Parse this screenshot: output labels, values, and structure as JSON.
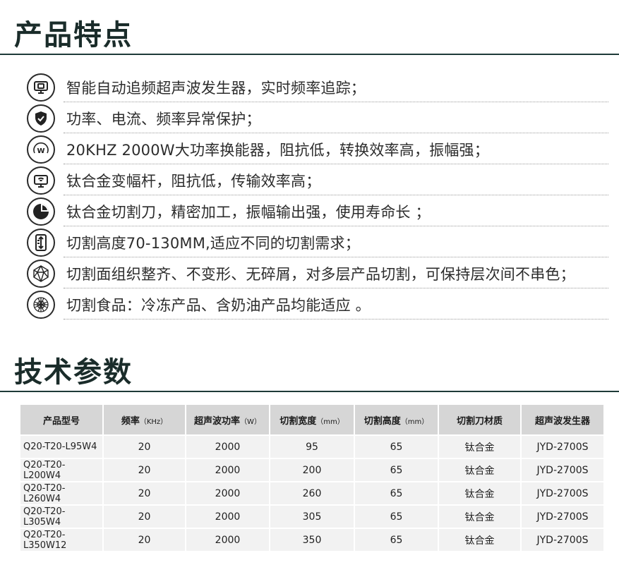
{
  "features_section": {
    "title": "产品特点",
    "items": [
      {
        "icon": "monitor-chip-icon",
        "text": "智能自动追频超声波发生器，实时频率追踪；"
      },
      {
        "icon": "shield-check-icon",
        "text": "功率、电流、频率异常保护；"
      },
      {
        "icon": "power-w-gauge-icon",
        "text": "20KHZ 2000W大功率换能器，阻抗低，转换效率高，振幅强；"
      },
      {
        "icon": "wireless-monitor-icon",
        "text": "钛合金变幅杆，阻抗低，传输效率高；"
      },
      {
        "icon": "pie-chart-icon",
        "text": "钛合金切割刀，精密加工，振幅输出强，使用寿命长 ；"
      },
      {
        "icon": "height-ruler-icon",
        "text": "切割高度70-130MM,适应不同的切割需求；"
      },
      {
        "icon": "polyhedron-icon",
        "text": "切割面组织整齐、不变形、无碎屑，对多层产品切割，可保持层次间不串色；"
      },
      {
        "icon": "mesh-flower-icon",
        "text": "切割食品：冷冻产品、含奶油产品均能适应 。"
      }
    ]
  },
  "specs_section": {
    "title": "技术参数",
    "headers": [
      {
        "label": "产品型号",
        "unit": ""
      },
      {
        "label": "频率",
        "unit": "（KHz）"
      },
      {
        "label": "超声波功率",
        "unit": "（W）"
      },
      {
        "label": "切割宽度",
        "unit": "（mm）"
      },
      {
        "label": "切割高度",
        "unit": "（mm）"
      },
      {
        "label": "切割刀材质",
        "unit": ""
      },
      {
        "label": "超声波发生器",
        "unit": ""
      }
    ],
    "rows": [
      [
        "Q20-T20-L95W4",
        "20",
        "2000",
        "95",
        "65",
        "钛合金",
        "JYD-2700S"
      ],
      [
        "Q20-T20-L200W4",
        "20",
        "2000",
        "200",
        "65",
        "钛合金",
        "JYD-2700S"
      ],
      [
        "Q20-T20-L260W4",
        "20",
        "2000",
        "260",
        "65",
        "钛合金",
        "JYD-2700S"
      ],
      [
        "Q20-T20-L305W4",
        "20",
        "2000",
        "305",
        "65",
        "钛合金",
        "JYD-2700S"
      ],
      [
        "Q20-T20-L350W12",
        "20",
        "2000",
        "350",
        "65",
        "钛合金",
        "JYD-2700S"
      ]
    ]
  },
  "colors": {
    "heading": "#1a2c2a",
    "rule": "#1e3a38",
    "table_header_bg": "#d6d6d6",
    "table_cell_bg": "#f2f2f2"
  }
}
